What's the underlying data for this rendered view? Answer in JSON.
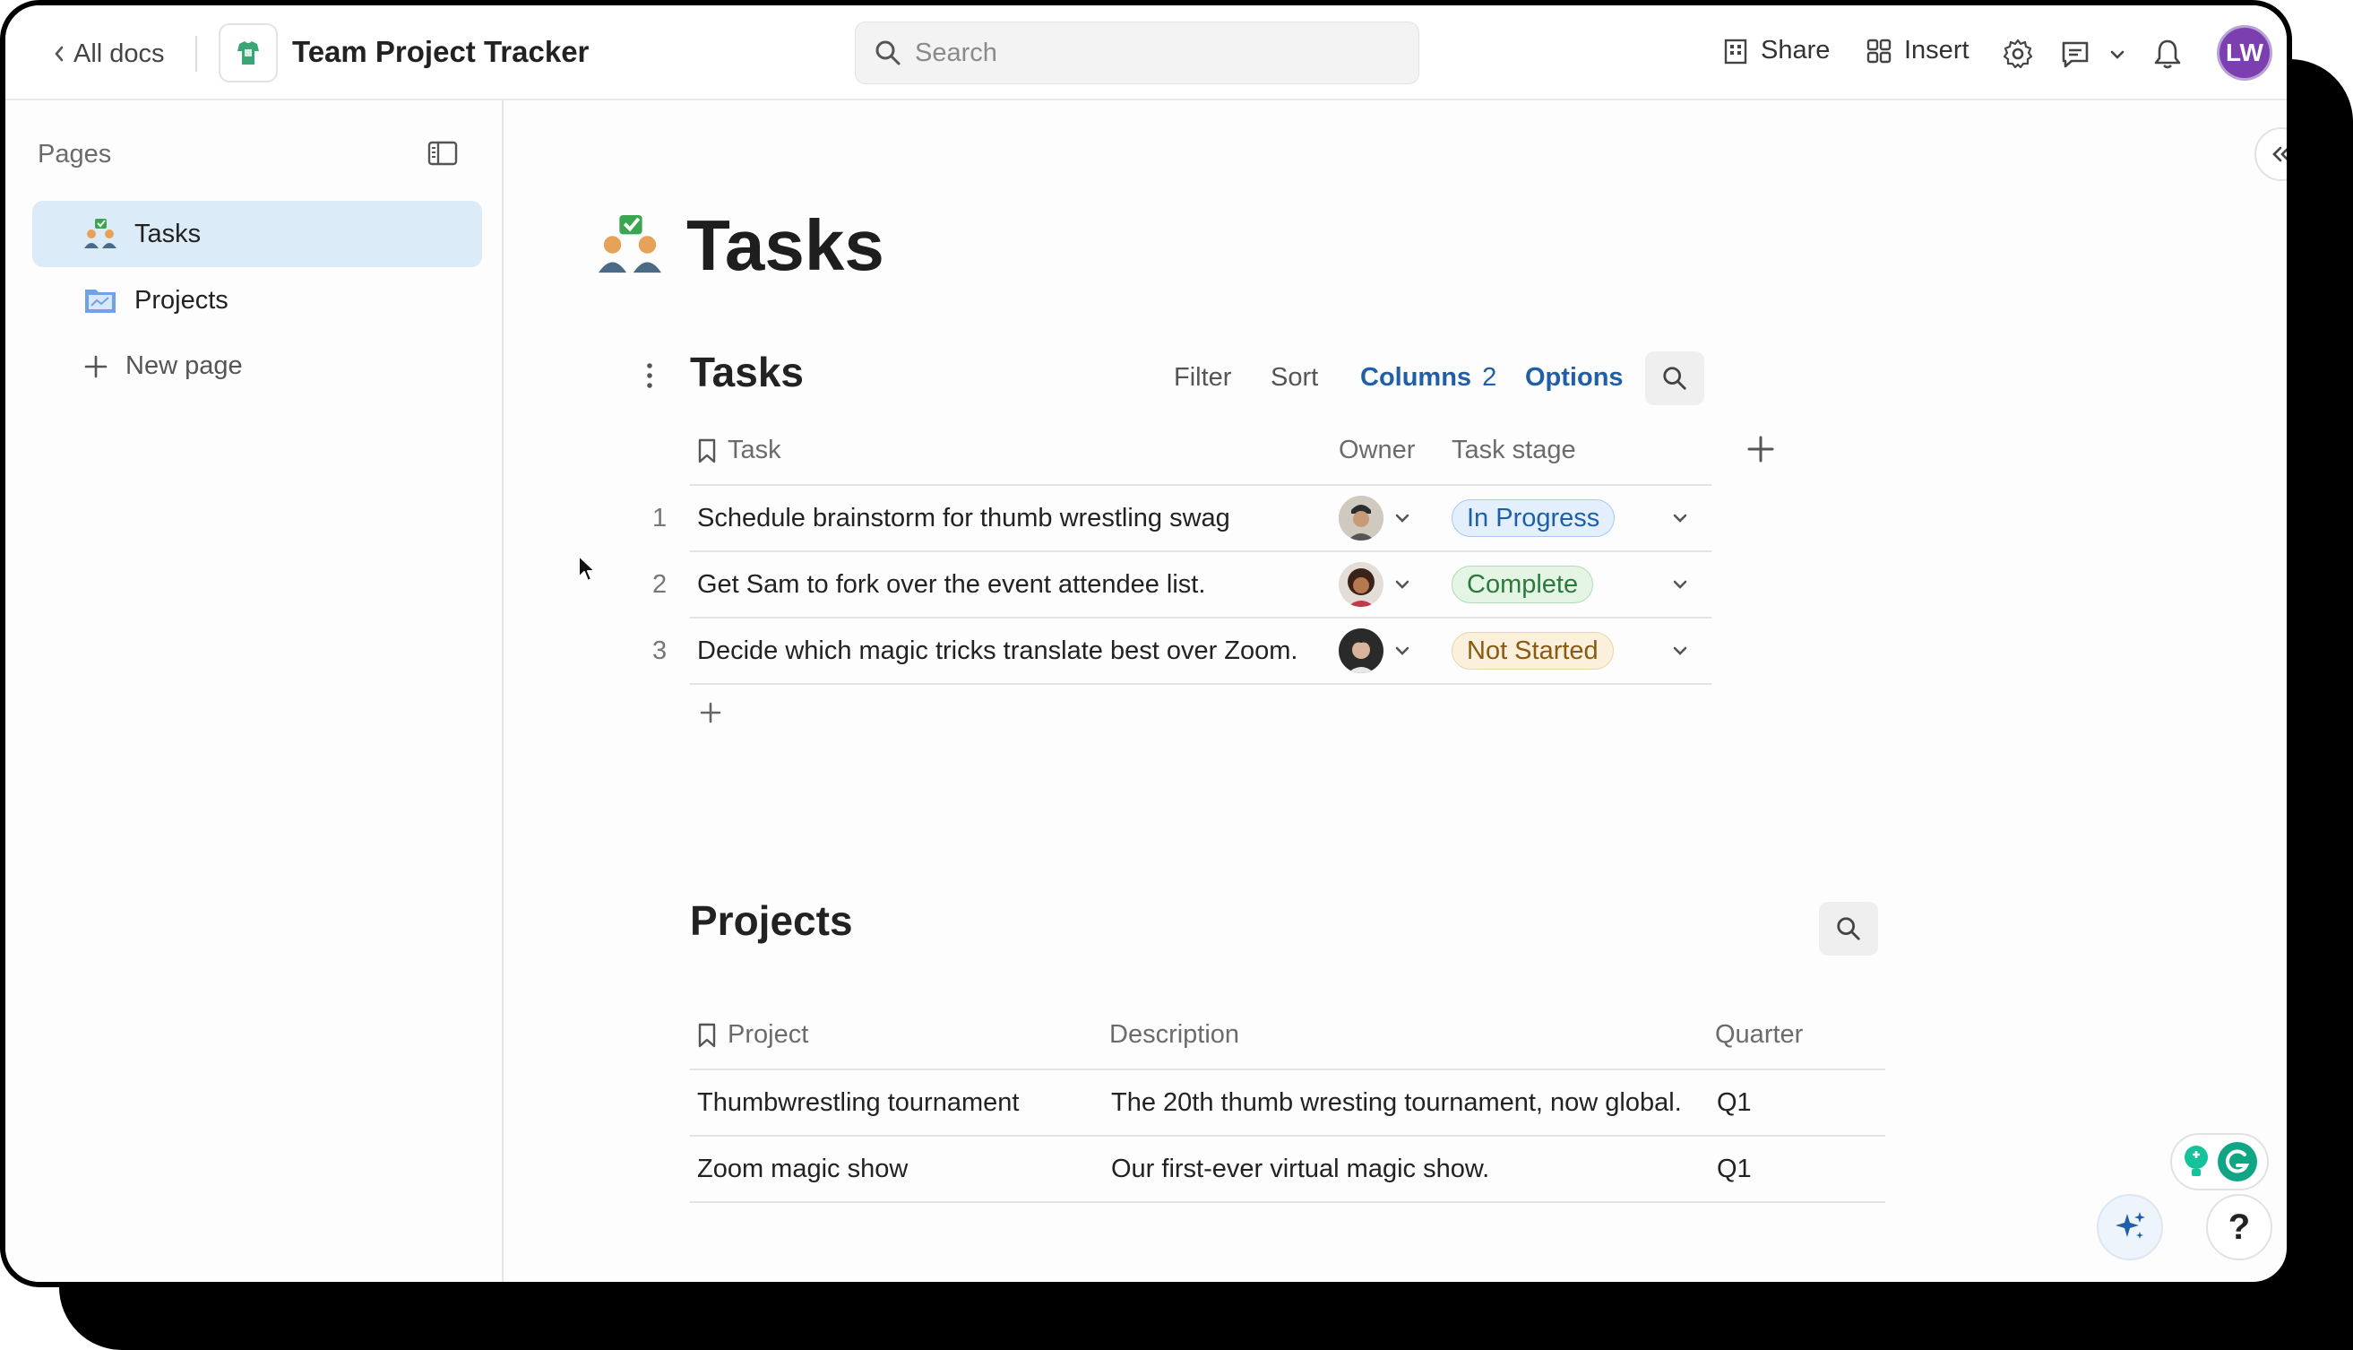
{
  "topbar": {
    "back_label": "All docs",
    "doc_title": "Team Project Tracker",
    "search_placeholder": "Search",
    "share_label": "Share",
    "insert_label": "Insert",
    "user_initials": "LW"
  },
  "sidebar": {
    "heading": "Pages",
    "items": [
      {
        "label": "Tasks",
        "selected": true
      },
      {
        "label": "Projects",
        "selected": false
      }
    ],
    "new_page_label": "New page"
  },
  "page": {
    "title": "Tasks"
  },
  "tasks_table": {
    "title": "Tasks",
    "toolbar": {
      "filter": "Filter",
      "sort": "Sort",
      "columns": "Columns",
      "columns_count": "2",
      "options": "Options"
    },
    "columns": [
      "Task",
      "Owner",
      "Task stage"
    ],
    "rows": [
      {
        "num": "1",
        "task": "Schedule brainstorm for thumb wrestling swag",
        "stage": "In Progress"
      },
      {
        "num": "2",
        "task": "Get Sam to fork over the event attendee list.",
        "stage": "Complete"
      },
      {
        "num": "3",
        "task": "Decide which magic tricks translate best over Zoom.",
        "stage": "Not Started"
      }
    ]
  },
  "projects_table": {
    "title": "Projects",
    "columns": [
      "Project",
      "Description",
      "Quarter"
    ],
    "rows": [
      {
        "project": "Thumbwrestling tournament",
        "description": "The 20th thumb wresting tournament, now global.",
        "quarter": "Q1"
      },
      {
        "project": "Zoom magic show",
        "description": "Our first-ever virtual magic show.",
        "quarter": "Q1"
      }
    ]
  },
  "help_label": "?",
  "colors": {
    "accent_blue": "#1f5fa8",
    "selected_bg": "#dcebf8",
    "avatar_purple": "#7b3fb0",
    "in_progress_bg": "#e3effc",
    "complete_bg": "#e4f5e6",
    "not_started_bg": "#fbf0dc"
  }
}
